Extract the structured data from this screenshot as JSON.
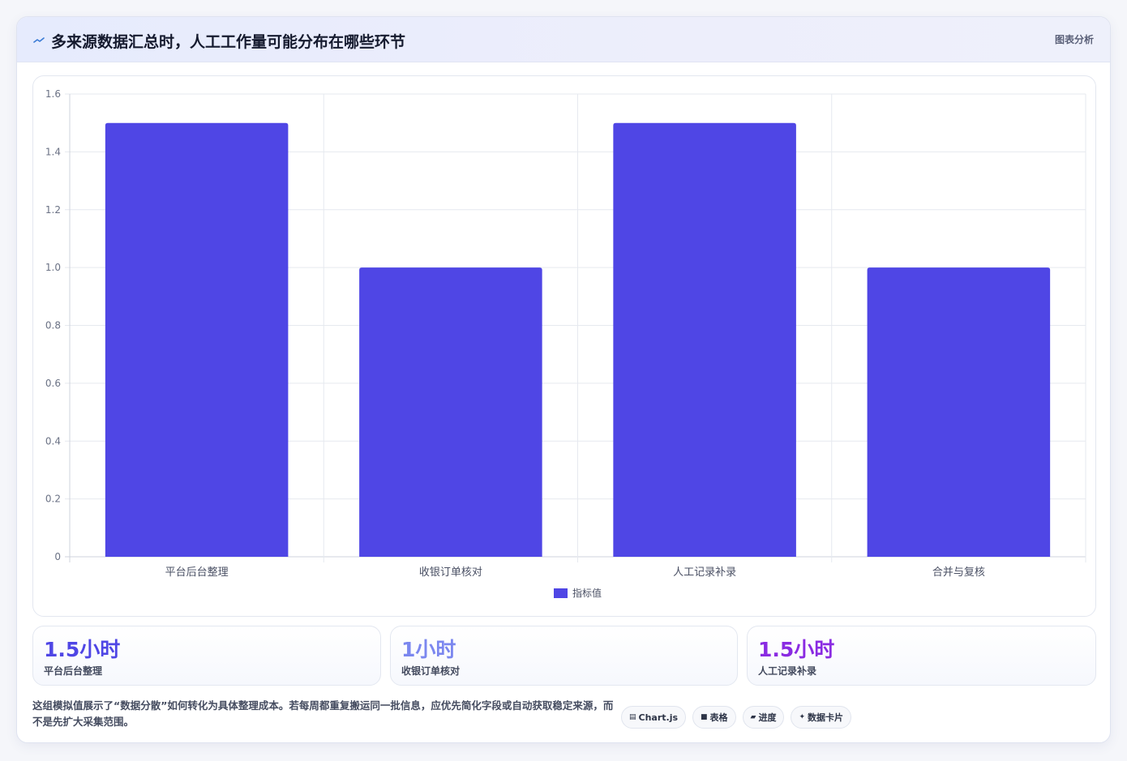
{
  "header": {
    "title": "多来源数据汇总时，人工工作量可能分布在哪些环节",
    "tag": "图表分析",
    "icon": "chart-line-icon"
  },
  "chart_data": {
    "type": "bar",
    "categories": [
      "平台后台整理",
      "收银订单核对",
      "人工记录补录",
      "合并与复核"
    ],
    "series": [
      {
        "name": "指标值",
        "values": [
          1.5,
          1.0,
          1.5,
          1.0
        ],
        "color": "#4f46e5"
      }
    ],
    "ylim": [
      0,
      1.6
    ],
    "yticks": [
      "0",
      "0.2",
      "0.4",
      "0.6",
      "0.8",
      "1.0",
      "1.2",
      "1.4",
      "1.6"
    ],
    "grid": true,
    "legend": "bottom"
  },
  "stats": [
    {
      "value": "1.5小时",
      "label": "平台后台整理",
      "color": "#4f46e5"
    },
    {
      "value": "1小时",
      "label": "收银订单核对",
      "color": "#7b87ef"
    },
    {
      "value": "1.5小时",
      "label": "人工记录补录",
      "color": "#8a2be2"
    }
  ],
  "footer": {
    "note": "这组模拟值展示了“数据分散”如何转化为具体整理成本。若每周都重复搬运同一批信息，应优先简化字段或自动获取稳定来源，而不是先扩大采集范围。",
    "chips": [
      {
        "icon": "▤",
        "label": "Chart.js"
      },
      {
        "icon": "■",
        "label": "表格"
      },
      {
        "icon": "▰",
        "label": "进度"
      },
      {
        "icon": "✦",
        "label": "数据卡片"
      }
    ]
  }
}
